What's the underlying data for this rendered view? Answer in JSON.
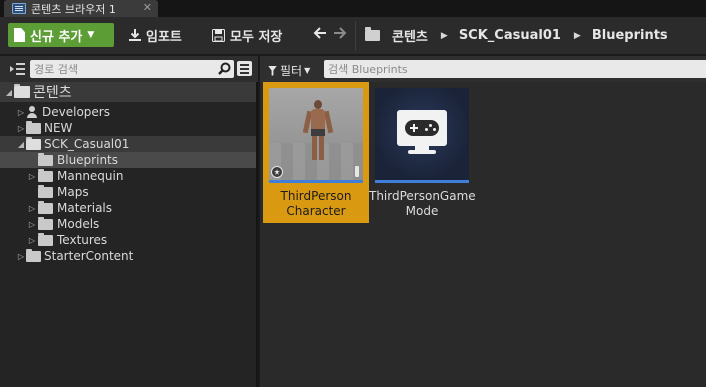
{
  "window": {
    "tab_title": "콘텐츠 브라우저 1",
    "tab_close": "✕"
  },
  "toolbar": {
    "add_new_label": "신규 추가",
    "import_label": "임포트",
    "save_all_label": "모두 저장",
    "back_icon": "‹",
    "forward_icon": "›"
  },
  "breadcrumbs": [
    "콘텐츠",
    "SCK_Casual01",
    "Blueprints"
  ],
  "sources_panel": {
    "search_placeholder": "경로 검색",
    "tree": [
      {
        "label": "콘텐츠",
        "depth": 0,
        "expanded": true,
        "icon": "folder-open-icon",
        "state": "root"
      },
      {
        "label": "Developers",
        "depth": 1,
        "expanded": false,
        "icon": "person-icon"
      },
      {
        "label": "NEW",
        "depth": 1,
        "expanded": false,
        "icon": "folder-icon"
      },
      {
        "label": "SCK_Casual01",
        "depth": 1,
        "expanded": true,
        "icon": "folder-icon",
        "state": "selected-parent"
      },
      {
        "label": "Blueprints",
        "depth": 2,
        "expanded": null,
        "icon": "folder-icon",
        "state": "selected"
      },
      {
        "label": "Mannequin",
        "depth": 2,
        "expanded": false,
        "icon": "folder-icon"
      },
      {
        "label": "Maps",
        "depth": 2,
        "expanded": null,
        "icon": "folder-icon"
      },
      {
        "label": "Materials",
        "depth": 2,
        "expanded": false,
        "icon": "folder-icon"
      },
      {
        "label": "Models",
        "depth": 2,
        "expanded": false,
        "icon": "folder-icon"
      },
      {
        "label": "Textures",
        "depth": 2,
        "expanded": false,
        "icon": "folder-icon"
      },
      {
        "label": "StarterContent",
        "depth": 1,
        "expanded": false,
        "icon": "folder-icon"
      }
    ]
  },
  "assets_panel": {
    "filter_label": "필터",
    "search_placeholder": "검색 Blueprints",
    "assets": [
      {
        "label_line1": "ThirdPerson",
        "label_line2": "Character",
        "selected": true,
        "icon": "character-thumbnail"
      },
      {
        "label_line1": "ThirdPersonGame",
        "label_line2": "Mode",
        "selected": false,
        "icon": "gamepad-monitor-icon"
      }
    ]
  },
  "colors": {
    "accent_green": "#5d9d36",
    "selection_orange": "#d99a12",
    "asset_bar_blue": "#3f7fd9"
  }
}
